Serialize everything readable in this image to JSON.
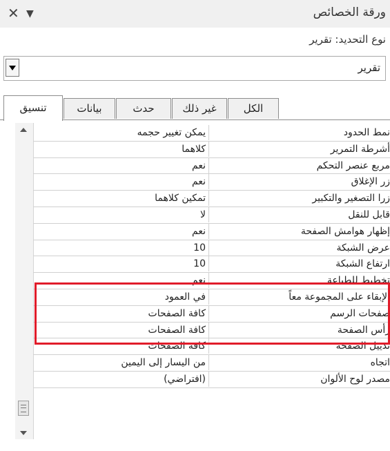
{
  "header": {
    "title": "ورقة الخصائص",
    "selection_type_label": "نوع التحديد:",
    "selection_type_value": "تقرير"
  },
  "selector": {
    "value": "تقرير"
  },
  "tabs": [
    {
      "label": "تنسيق",
      "active": true
    },
    {
      "label": "بيانات",
      "active": false
    },
    {
      "label": "حدث",
      "active": false
    },
    {
      "label": "غير ذلك",
      "active": false
    },
    {
      "label": "الكل",
      "active": false
    }
  ],
  "properties": [
    {
      "name": "نمط الحدود",
      "value": "يمكن تغيير حجمه"
    },
    {
      "name": "أشرطة التمرير",
      "value": "كلاهما"
    },
    {
      "name": "مربع عنصر التحكم",
      "value": "نعم"
    },
    {
      "name": "زر الإغلاق",
      "value": "نعم"
    },
    {
      "name": "زرا التصغير والتكبير",
      "value": "تمكين كلاهما"
    },
    {
      "name": "قابل للنقل",
      "value": "لا"
    },
    {
      "name": "إظهار هوامش الصفحة",
      "value": "نعم"
    },
    {
      "name": "عرض الشبكة",
      "value": "10"
    },
    {
      "name": "ارتفاع الشبكة",
      "value": "10"
    },
    {
      "name": "تخطيط للطباعة",
      "value": "نعم"
    },
    {
      "name": "الإبقاء على المجموعة معاً",
      "value": "في العمود"
    },
    {
      "name": "صفحات الرسم",
      "value": "كافة الصفحات"
    },
    {
      "name": "رأس الصفحة",
      "value": "كافة الصفحات"
    },
    {
      "name": "تذييل الصفحة",
      "value": "كافة الصفحات"
    },
    {
      "name": "اتجاه",
      "value": "من اليسار إلى اليمين"
    },
    {
      "name": "مصدر لوح الألوان",
      "value": "(افتراضي)"
    }
  ],
  "highlight": {
    "color": "#e11c2a",
    "rows": [
      "عرض الشبكة",
      "ارتفاع الشبكة"
    ]
  },
  "icons": [
    "close-icon",
    "dropdown-arrow-icon",
    "scroll-up-icon",
    "scroll-down-icon",
    "scroll-thumb-icon"
  ]
}
